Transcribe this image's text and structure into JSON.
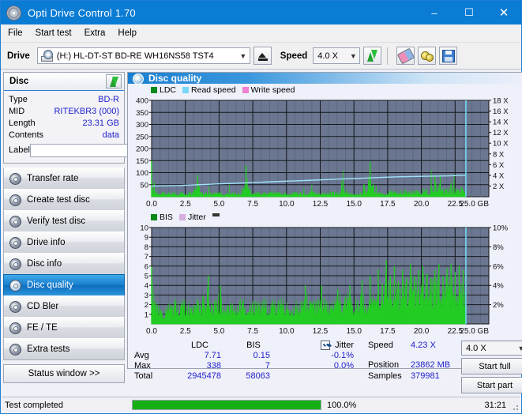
{
  "window": {
    "title": "Opti Drive Control 1.70",
    "icon": "disc-icon",
    "minimize": "–",
    "maximize": "☐",
    "close": "✕"
  },
  "menu": {
    "items": [
      "File",
      "Start test",
      "Extra",
      "Help"
    ]
  },
  "toolbar": {
    "drive_label": "Drive",
    "drive_value": "(H:)   HL-DT-ST BD-RE  WH16NS58 TST4",
    "eject_icon": "eject-icon",
    "speed_label": "Speed",
    "speed_value": "4.0 X",
    "refresh_icon": "refresh-arrows-icon",
    "erase_icon": "eraser-icon",
    "tools_icon": "tools-icon",
    "save_icon": "save-floppy-icon"
  },
  "disc": {
    "title": "Disc",
    "refresh_icon": "refresh-arrows-icon",
    "rows": [
      {
        "key": "Type",
        "value": "BD-R"
      },
      {
        "key": "MID",
        "value": "RITEKBR3 (000)"
      },
      {
        "key": "Length",
        "value": "23.31 GB"
      },
      {
        "key": "Contents",
        "value": "data"
      }
    ],
    "label_key": "Label",
    "label_value": "",
    "label_placeholder": "",
    "disc_button_icon": "cd-disc-icon"
  },
  "sidebar": {
    "items": [
      {
        "label": "Transfer rate",
        "selected": false
      },
      {
        "label": "Create test disc",
        "selected": false
      },
      {
        "label": "Verify test disc",
        "selected": false
      },
      {
        "label": "Drive info",
        "selected": false
      },
      {
        "label": "Disc info",
        "selected": false
      },
      {
        "label": "Disc quality",
        "selected": true
      },
      {
        "label": "CD Bler",
        "selected": false
      },
      {
        "label": "FE / TE",
        "selected": false
      },
      {
        "label": "Extra tests",
        "selected": false
      }
    ],
    "status_window_button": "Status window >>"
  },
  "panel": {
    "title": "Disc quality",
    "icon": "disc-quality-icon"
  },
  "chart_data": [
    {
      "type": "area",
      "title": "LDC / Read speed",
      "xlabel": "GB",
      "ylabel": "LDC",
      "xlim": [
        0,
        25
      ],
      "xticks": [
        "0.0",
        "2.5",
        "5.0",
        "7.5",
        "10.0",
        "12.5",
        "15.0",
        "17.5",
        "20.0",
        "22.5",
        "25.0 GB"
      ],
      "ylim": [
        0,
        400
      ],
      "yticks": [
        "50",
        "100",
        "150",
        "200",
        "250",
        "300",
        "350",
        "400"
      ],
      "y2lim": [
        0,
        18
      ],
      "y2ticks": [
        "2 X",
        "4 X",
        "6 X",
        "8 X",
        "10 X",
        "12 X",
        "14 X",
        "16 X",
        "18 X"
      ],
      "grid": true,
      "legend": [
        {
          "name": "LDC",
          "color": "#0a8a19"
        },
        {
          "name": "Read speed",
          "color": "#7ad6f5"
        },
        {
          "name": "Write speed",
          "color": "#ef7fd0"
        }
      ],
      "series": [
        {
          "name": "LDC",
          "color": "#22cc22",
          "kind": "area",
          "x": [
            0.0,
            0.2,
            0.4,
            0.7,
            1.0,
            1.4,
            1.8,
            2.2,
            2.6,
            3.0,
            3.4,
            3.8,
            4.2,
            4.6,
            5.0,
            5.4,
            5.8,
            6.2,
            6.6,
            7.0,
            7.4,
            7.8,
            8.2,
            8.6,
            9.0,
            9.4,
            9.8,
            10.2,
            10.6,
            11.0,
            11.4,
            11.8,
            12.2,
            12.6,
            13.0,
            13.4,
            13.8,
            14.2,
            14.6,
            15.0,
            15.4,
            15.8,
            16.2,
            16.6,
            17.0,
            17.4,
            17.8,
            18.2,
            18.6,
            19.0,
            19.4,
            19.8,
            20.2,
            20.6,
            21.0,
            21.4,
            21.8,
            22.2,
            22.6,
            23.0,
            23.3
          ],
          "y": [
            150,
            60,
            30,
            28,
            26,
            30,
            24,
            26,
            22,
            28,
            90,
            24,
            30,
            22,
            28,
            24,
            30,
            26,
            24,
            130,
            30,
            28,
            24,
            26,
            30,
            24,
            28,
            26,
            30,
            24,
            26,
            28,
            30,
            26,
            24,
            28,
            30,
            60,
            28,
            26,
            30,
            28,
            145,
            30,
            26,
            34,
            38,
            36,
            40,
            44,
            38,
            42,
            46,
            44,
            90,
            85,
            52,
            56,
            48,
            50,
            46
          ]
        },
        {
          "name": "Read speed",
          "color": "#7ad6f5",
          "kind": "line",
          "x": [
            0.0,
            1.0,
            2.0,
            3.0,
            4.0,
            5.0,
            6.0,
            7.0,
            8.0,
            9.0,
            10.0,
            11.0,
            12.0,
            13.0,
            14.0,
            15.0,
            16.0,
            17.0,
            18.0,
            19.0,
            20.0,
            21.0,
            22.0,
            23.0,
            23.3
          ],
          "y": [
            2.0,
            2.05,
            2.1,
            2.2,
            2.3,
            2.4,
            2.5,
            2.6,
            2.7,
            2.8,
            2.9,
            3.0,
            3.1,
            3.2,
            3.3,
            3.4,
            3.5,
            3.6,
            3.7,
            3.75,
            3.8,
            3.85,
            3.9,
            4.0,
            4.0
          ]
        }
      ],
      "end_marker": {
        "position": 23.3,
        "color": "#6fd8f2"
      },
      "avg_speed": "4.23 X"
    },
    {
      "type": "area",
      "title": "BIS / Jitter",
      "xlabel": "GB",
      "ylabel": "BIS",
      "xlim": [
        0,
        25
      ],
      "xticks": [
        "0.0",
        "2.5",
        "5.0",
        "7.5",
        "10.0",
        "12.5",
        "15.0",
        "17.5",
        "20.0",
        "22.5",
        "25.0 GB"
      ],
      "ylim": [
        0,
        10
      ],
      "yticks": [
        "1",
        "2",
        "3",
        "4",
        "5",
        "6",
        "7",
        "8",
        "9",
        "10"
      ],
      "y2lim": [
        0,
        10
      ],
      "y2ticks": [
        "2%",
        "4%",
        "6%",
        "8%",
        "10%"
      ],
      "grid": true,
      "legend": [
        {
          "name": "BIS",
          "color": "#0a8a19"
        },
        {
          "name": "Jitter",
          "color": "#d8aede"
        }
      ],
      "series": [
        {
          "name": "BIS",
          "color": "#22cc22",
          "kind": "area",
          "x": [
            0.0,
            0.3,
            0.6,
            0.9,
            1.2,
            1.5,
            1.8,
            2.1,
            2.4,
            2.7,
            3.0,
            3.3,
            3.6,
            3.9,
            4.2,
            4.5,
            4.8,
            5.1,
            5.4,
            5.7,
            6.0,
            6.3,
            6.6,
            6.9,
            7.2,
            7.5,
            7.8,
            8.1,
            8.4,
            8.7,
            9.0,
            9.3,
            9.6,
            9.9,
            10.2,
            10.5,
            10.8,
            11.1,
            11.4,
            11.7,
            12.0,
            12.3,
            12.6,
            12.9,
            13.2,
            13.5,
            13.8,
            14.1,
            14.4,
            14.7,
            15.0,
            15.3,
            15.6,
            15.9,
            16.2,
            16.5,
            16.8,
            17.1,
            17.4,
            17.7,
            18.0,
            18.3,
            18.6,
            18.9,
            19.2,
            19.5,
            19.8,
            20.1,
            20.4,
            20.7,
            21.0,
            21.3,
            21.6,
            21.9,
            22.2,
            22.5,
            22.8,
            23.1,
            23.3
          ],
          "y": [
            6.0,
            3.0,
            2.6,
            1.2,
            2.8,
            2.6,
            3.0,
            2.4,
            2.8,
            2.6,
            3.0,
            2.6,
            2.8,
            3.0,
            5.0,
            2.8,
            3.0,
            4.0,
            2.6,
            3.0,
            2.8,
            3.0,
            2.6,
            3.0,
            2.8,
            3.0,
            2.6,
            2.8,
            3.0,
            2.8,
            3.0,
            2.6,
            3.0,
            2.8,
            3.0,
            2.6,
            3.0,
            2.8,
            4.0,
            3.0,
            2.8,
            3.0,
            4.0,
            3.0,
            2.8,
            3.0,
            3.6,
            2.8,
            3.0,
            4.0,
            2.8,
            3.2,
            4.5,
            3.0,
            5.0,
            3.4,
            5.6,
            4.2,
            6.6,
            5.0,
            6.0,
            4.4,
            5.6,
            4.8,
            6.2,
            5.0,
            5.6,
            6.0,
            5.2,
            4.8,
            5.6,
            6.2,
            5.0,
            5.8,
            6.2,
            5.4,
            6.0,
            5.6,
            5.0
          ]
        }
      ],
      "end_marker": {
        "position": 23.3,
        "color": "#6fd8f2"
      }
    }
  ],
  "stats": {
    "headers": {
      "ldc": "LDC",
      "bis": "BIS",
      "jitter": "Jitter"
    },
    "rows": [
      {
        "key": "Avg",
        "ldc": "7.71",
        "bis": "0.15",
        "jitter": "-0.1%"
      },
      {
        "key": "Max",
        "ldc": "338",
        "bis": "7",
        "jitter": "0.0%"
      },
      {
        "key": "Total",
        "ldc": "2945478",
        "bis": "58063",
        "jitter": ""
      }
    ],
    "jitter_checked": true,
    "speed_key": "Speed",
    "speed_value": "4.23 X",
    "position_key": "Position",
    "position_value": "23862 MB",
    "samples_key": "Samples",
    "samples_value": "379981",
    "speed_select": "4.0 X",
    "start_full_button": "Start full",
    "start_part_button": "Start part"
  },
  "statusbar": {
    "text": "Test completed",
    "progress_percent": 100,
    "progress_label": "100.0%",
    "elapsed": "31:21"
  },
  "colors": {
    "accent": "#0a7cd4",
    "value_text": "#2222cc",
    "chart_bg": "#6b7791",
    "chart_green": "#22cc22",
    "read_speed": "#7ad6f5",
    "progress": "#16b016"
  }
}
